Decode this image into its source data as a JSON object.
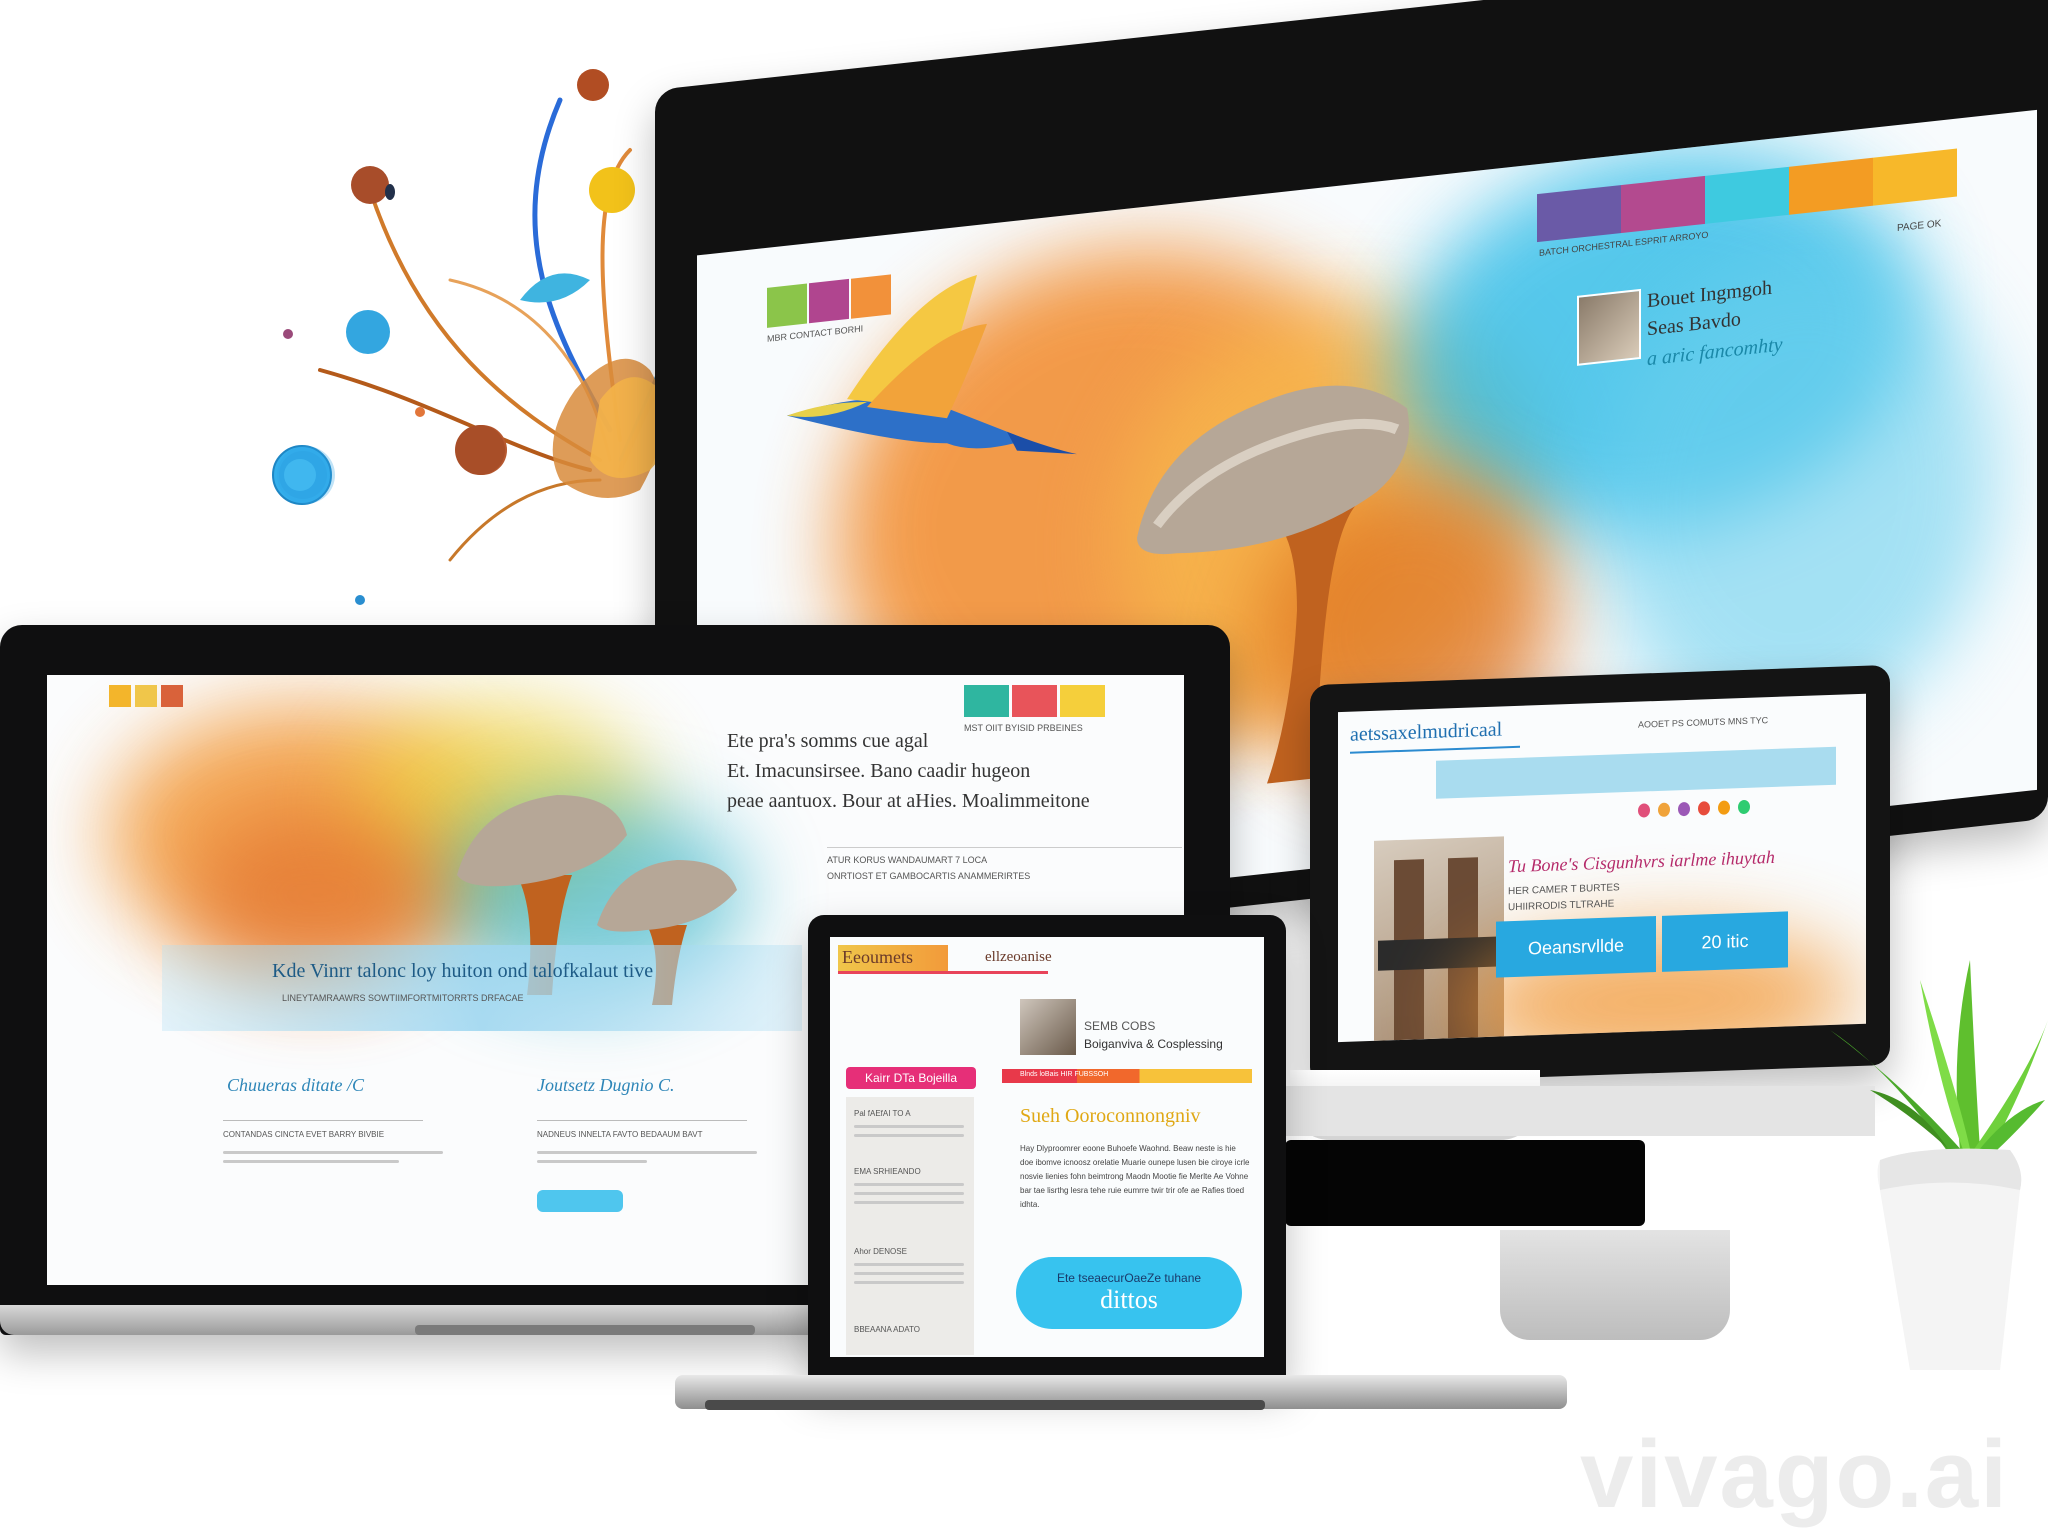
{
  "desktop": {
    "nav_text": "BATCH ORCHESTRAL ESPRIT ARROYO",
    "nav_sub": "PAGE OK",
    "hero_swatch_caption": "MBR CONTACT BORHI",
    "profile": {
      "line1": "Bouet Ingmgoh",
      "line2": "Seas Bavdo",
      "line3": "a aric fancomhty"
    },
    "colors": [
      "#6a5aa7",
      "#b34a8f",
      "#3ecae0",
      "#f39c23",
      "#f7b82a",
      "#ef6f2b"
    ]
  },
  "laptop": {
    "hero_line1": "Ete pra's somms cue agal",
    "hero_line2": "Et. Imacunsirsee. Bano caadir hugeon",
    "hero_line3": "peae aantuox. Bour at aHies. Moalimmeitone",
    "meta_line1": "ATUR KORUS WANDAUMART 7 LOCA",
    "meta_line2": "ONRTIOST ET GAMBOCARTIS ANAMMERIRTES",
    "strip_caption": "MST OIIT BYISID PRBEINES",
    "banner_title": "Kde Vinrr talonc loy huiton ond talofkalaut tive",
    "banner_sub": "LINEYTAMRAAWRS SOWTIIMFORTMITORRTS DRFACAE",
    "col1_title": "Chuueras ditate /C",
    "col2_title": "Joutsetz Dugnio C.",
    "col1_text": "CONTANDAS CINCTA EVET BARRY BIVBIE",
    "col2_text": "NADNEUS INNELTA FAVTO BEDAAUM BAVT"
  },
  "monitor_small": {
    "nav_logo": "aetssaxelmudricaal",
    "nav_links": "AOOET  PS COMUTS  MNS  TYC",
    "headline": "Tu Bone's Cisgunhvrs iarlme ihuytah",
    "subline1": "HER CAMER T BURTES",
    "subline2": "UHIIRRODIS TLTRAHE",
    "btn1": "Oeansrvllde",
    "btn2": "20 itic",
    "dot_colors": [
      "#e04f7a",
      "#f0a33a",
      "#9b59b6",
      "#e74c3c",
      "#f39c12",
      "#2ecc71"
    ]
  },
  "tablet": {
    "logo": "Eeoumets",
    "logo_right": "ellzeoanise",
    "card_title": "SEMB COBS",
    "card_sub": "Boiganviva & Cosplessing",
    "tag_pink": "Kairr DTa Bojeilla",
    "tag_strip": "Blnds  loBais  HIR FUBSSOH",
    "headline": "Sueh Ooroconnongniv",
    "body": "Hay Dlyproomrer eoone Buhoefe Waohnd. Beaw neste is hie doe ibomve icnoosz orelatie Muarie ounepe lusen bie ciroye icrle nosvie lienies fohn beimtrong Maodn Mootie fie Merlte Ae Vohne bar tae lisrthg lesra tehe ruie eumrre twir trir ofe ae Rafies tloed idhta.",
    "btn_small": "Ete tseaecurOaeZe tuhane",
    "btn_big": "dittos",
    "side_list": [
      "Pal fAEfAI TO A",
      "EMA SRHIEANDO",
      "Ahor DENOSE",
      "BBEAANA ADATO"
    ]
  },
  "watermark": "vivago.ai"
}
